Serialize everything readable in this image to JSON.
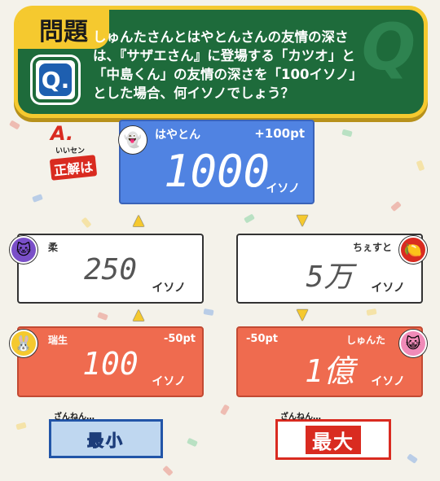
{
  "colors": {
    "board_green": "#1e6b3b",
    "board_frame": "#f5c92f",
    "card_top_blue": "#5083e2",
    "card_red": "#ef6b4f",
    "card_white": "#ffffff",
    "arrow_yellow": "#f5c92f",
    "stamp_min_blue": "#2255a8",
    "stamp_max_red": "#d92b20"
  },
  "question": {
    "heading": "問題",
    "badge": "Q.",
    "text": "しゅんたさんとはやとんさんの友情の深さ\nは、『サザエさん』に登場する「カツオ」と\n「中島くん」の友情の深さを「100イソノ」\nとした場合、何イソノでしょう？"
  },
  "answer_label": {
    "letter": "A.",
    "sub": "いいセン",
    "correct": "正解は"
  },
  "cards": {
    "top": {
      "name": "はやとん",
      "points": "+100pt",
      "value": "1000",
      "unit": "イソノ",
      "avatar_icon": "ghost-icon"
    },
    "left_mid": {
      "name": "柔",
      "value": "250",
      "unit": "イソノ",
      "avatar_icon": "purple-cat-icon"
    },
    "right_mid": {
      "name": "ちぇすと",
      "value": "5万",
      "unit": "イソノ",
      "avatar_icon": "lemon-icon"
    },
    "left_bot": {
      "name": "瑞生",
      "points": "-50pt",
      "value": "100",
      "unit": "イソノ",
      "avatar_icon": "rabbit-icon"
    },
    "right_bot": {
      "name": "しゅんた",
      "points": "-50pt",
      "value": "1億",
      "unit": "イソノ",
      "avatar_icon": "pink-cat-icon"
    }
  },
  "stamps": {
    "min": {
      "prefix": "ざんねん…",
      "word": "最小"
    },
    "max": {
      "prefix": "ざんねん…",
      "word": "最大"
    }
  }
}
